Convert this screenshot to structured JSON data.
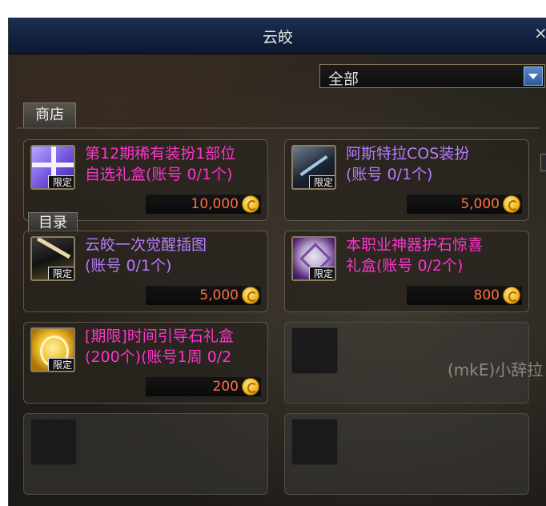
{
  "window": {
    "title": "云皎",
    "close_glyph": "×"
  },
  "filter": {
    "selected": "全部",
    "arrow_icon": "chevron-down-icon"
  },
  "tabs": [
    {
      "label": "商店"
    }
  ],
  "catalog_button": {
    "label": "目录"
  },
  "background_text": "(mkΕ)小辞拉",
  "items": [
    {
      "name_line1": "第12期稀有装扮1部位",
      "name_line2": "自选礼盒(账号 0/1个)",
      "name_color": "#ff33cc",
      "badge": "限定",
      "price": "10,000",
      "icon": "gift-box-icon"
    },
    {
      "name_line1": "阿斯特拉COS装扮",
      "name_line2": "(账号 0/1个)",
      "name_color": "#b77cff",
      "badge": "限定",
      "price": "5,000",
      "icon": "costume-icon"
    },
    {
      "name_line1": "云皎一次觉醒插图",
      "name_line2": "(账号 0/1个)",
      "name_color": "#b77cff",
      "badge": "限定",
      "price": "5,000",
      "icon": "illustration-icon"
    },
    {
      "name_line1": "本职业神器护石惊喜",
      "name_line2": "礼盒(账号 0/2个)",
      "name_color": "#ff33cc",
      "badge": "限定",
      "price": "800",
      "icon": "talisman-box-icon"
    },
    {
      "name_line1": "[期限]时间引导石礼盒",
      "name_line2": "(200个)(账号1周 0/2",
      "name_color": "#ff33cc",
      "badge": "限定",
      "price": "200",
      "icon": "guide-stone-icon"
    }
  ],
  "currency_icon": "gold-coin-icon"
}
